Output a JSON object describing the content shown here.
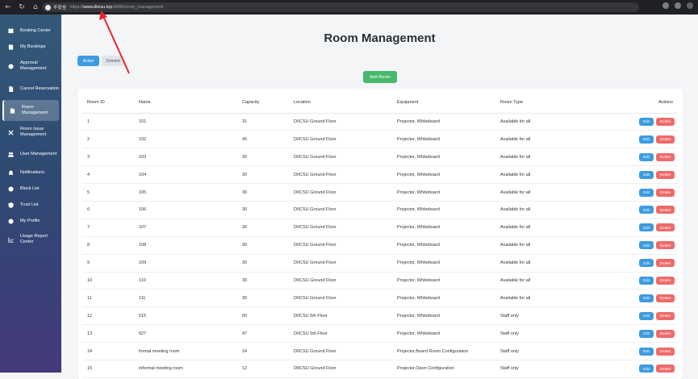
{
  "browser": {
    "insecure_label": "不安全",
    "url_prefix": "https://",
    "url_host": "www.diicsu.top",
    "url_path": ":8080/room_management"
  },
  "sidebar": {
    "items": [
      {
        "label": "Booking Center",
        "icon": "calendar-icon",
        "active": false
      },
      {
        "label": "My Bookings",
        "icon": "book-icon",
        "active": false
      },
      {
        "label": "Approval Management",
        "icon": "check-circle-icon",
        "active": false
      },
      {
        "label": "Cancel Reservation",
        "icon": "cancel-document-icon",
        "active": false
      },
      {
        "label": "Room Management",
        "icon": "door-icon",
        "active": true
      },
      {
        "label": "Room Issue Management",
        "icon": "tools-icon",
        "active": false
      },
      {
        "label": "User Management",
        "icon": "users-icon",
        "active": false
      },
      {
        "label": "Notifications",
        "icon": "bell-icon",
        "active": false
      },
      {
        "label": "Black List",
        "icon": "ban-icon",
        "active": false
      },
      {
        "label": "Trust List",
        "icon": "shield-icon",
        "active": false
      },
      {
        "label": "My Profile",
        "icon": "user-icon",
        "active": false
      },
      {
        "label": "Usage Report Center",
        "icon": "chart-icon",
        "active": false
      }
    ]
  },
  "page": {
    "title": "Room Management",
    "filter_active": "Active",
    "filter_deleted": "Deleted",
    "add_room": "Add Room"
  },
  "table": {
    "headers": [
      "Room ID",
      "Name",
      "Capacity",
      "Location",
      "Equipment",
      "Room Type",
      "Actions"
    ],
    "edit_label": "Edit",
    "delete_label": "Delete",
    "rows": [
      [
        "1",
        "101",
        "31",
        "DIICSU Ground Floor",
        "Projector, Whiteboard",
        "Available for all"
      ],
      [
        "2",
        "102",
        "40",
        "DIICSU Ground Floor",
        "Projector, Whiteboard",
        "Available for all"
      ],
      [
        "3",
        "103",
        "30",
        "DIICSU Ground Floor",
        "Projector, Whiteboard",
        "Available for all"
      ],
      [
        "4",
        "104",
        "30",
        "DIICSU Ground Floor",
        "Projector, Whiteboard",
        "Available for all"
      ],
      [
        "5",
        "105",
        "30",
        "DIICSU Ground Floor",
        "Projector, Whiteboard",
        "Available for all"
      ],
      [
        "6",
        "106",
        "30",
        "DIICSU Ground Floor",
        "Projector, Whiteboard",
        "Available for all"
      ],
      [
        "7",
        "107",
        "30",
        "DIICSU Ground Floor",
        "Projector, Whiteboard",
        "Available for all"
      ],
      [
        "8",
        "108",
        "30",
        "DIICSU Ground Floor",
        "Projector, Whiteboard",
        "Available for all"
      ],
      [
        "9",
        "109",
        "30",
        "DIICSU Ground Floor",
        "Projector, Whiteboard",
        "Available for all"
      ],
      [
        "10",
        "110",
        "30",
        "DIICSU Ground Floor",
        "Projector, Whiteboard",
        "Available for all"
      ],
      [
        "11",
        "111",
        "30",
        "DIICSU Ground Floor",
        "Projector, Whiteboard",
        "Available for all"
      ],
      [
        "12",
        "615",
        "60",
        "DIICSU 5th Floor",
        "Projector, Whiteboard",
        "Staff only"
      ],
      [
        "13",
        "627",
        "47",
        "DIICSU 5th Floor",
        "Projector, Whiteboard",
        "Staff only"
      ],
      [
        "14",
        "formal meeting room",
        "14",
        "DIICSU Ground Floor",
        "Projector,Board Room Configuration",
        "Staff only"
      ],
      [
        "15",
        "informal meeting room",
        "12",
        "DIICSU Ground Floor",
        "Projector,Open Configuration",
        "Staff only"
      ]
    ]
  },
  "colors": {
    "primary": "#3d9be0",
    "danger": "#ef6a6a",
    "success": "#48b86b",
    "annotation_arrow": "#e8262b"
  }
}
